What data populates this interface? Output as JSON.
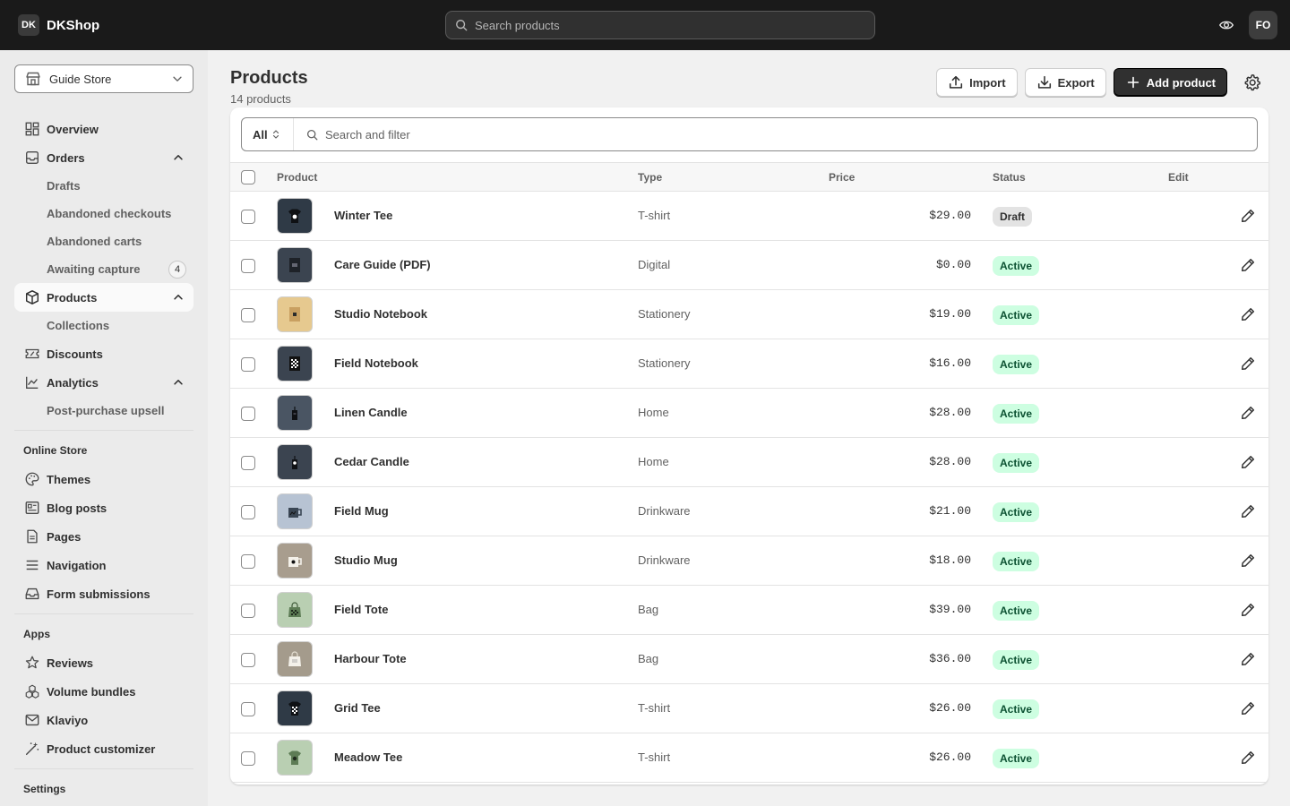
{
  "brand": {
    "logo_text": "DK",
    "name": "DKShop"
  },
  "top_search": {
    "placeholder": "Search products"
  },
  "user": {
    "initials": "FO"
  },
  "store_selector": {
    "label": "Guide Store"
  },
  "sidebar": {
    "overview": "Overview",
    "orders": "Orders",
    "orders_sub": [
      "Drafts",
      "Abandoned checkouts",
      "Abandoned carts",
      "Awaiting capture"
    ],
    "awaiting_capture_badge": "4",
    "products": "Products",
    "products_sub": [
      "Collections"
    ],
    "discounts": "Discounts",
    "analytics": "Analytics",
    "analytics_sub": [
      "Post-purchase upsell"
    ],
    "online_store_heading": "Online Store",
    "online_store": [
      "Themes",
      "Blog posts",
      "Pages",
      "Navigation",
      "Form submissions"
    ],
    "apps_heading": "Apps",
    "apps": [
      "Reviews",
      "Volume bundles",
      "Klaviyo",
      "Product customizer"
    ],
    "settings_heading": "Settings"
  },
  "page": {
    "title": "Products",
    "subtitle": "14 products"
  },
  "actions": {
    "import": "Import",
    "export": "Export",
    "add": "Add product"
  },
  "filter": {
    "tab": "All",
    "placeholder": "Search and filter"
  },
  "table": {
    "headers": {
      "product": "Product",
      "type": "Type",
      "price": "Price",
      "status": "Status",
      "edit": "Edit"
    },
    "rows": [
      {
        "name": "Winter Tee",
        "type": "T-shirt",
        "price": "$29.00",
        "status": "Draft",
        "thumb": "#2f3a46"
      },
      {
        "name": "Care Guide (PDF)",
        "type": "Digital",
        "price": "$0.00",
        "status": "Active",
        "thumb": "#3b4450"
      },
      {
        "name": "Studio Notebook",
        "type": "Stationery",
        "price": "$19.00",
        "status": "Active",
        "thumb": "#e6c98f"
      },
      {
        "name": "Field Notebook",
        "type": "Stationery",
        "price": "$16.00",
        "status": "Active",
        "thumb": "#3b4450"
      },
      {
        "name": "Linen Candle",
        "type": "Home",
        "price": "$28.00",
        "status": "Active",
        "thumb": "#4a5563"
      },
      {
        "name": "Cedar Candle",
        "type": "Home",
        "price": "$28.00",
        "status": "Active",
        "thumb": "#3b4450"
      },
      {
        "name": "Field Mug",
        "type": "Drinkware",
        "price": "$21.00",
        "status": "Active",
        "thumb": "#b7c3d3"
      },
      {
        "name": "Studio Mug",
        "type": "Drinkware",
        "price": "$18.00",
        "status": "Active",
        "thumb": "#a89d8e"
      },
      {
        "name": "Field Tote",
        "type": "Bag",
        "price": "$39.00",
        "status": "Active",
        "thumb": "#b9cfb2"
      },
      {
        "name": "Harbour Tote",
        "type": "Bag",
        "price": "$36.00",
        "status": "Active",
        "thumb": "#a49b8c"
      },
      {
        "name": "Grid Tee",
        "type": "T-shirt",
        "price": "$26.00",
        "status": "Active",
        "thumb": "#2f3a46"
      },
      {
        "name": "Meadow Tee",
        "type": "T-shirt",
        "price": "$26.00",
        "status": "Active",
        "thumb": "#b9cfb2"
      }
    ]
  },
  "colors": {
    "active_bg": "#cdfee1",
    "active_fg": "#0c5132",
    "draft_bg": "#e3e3e3",
    "draft_fg": "#303030"
  }
}
